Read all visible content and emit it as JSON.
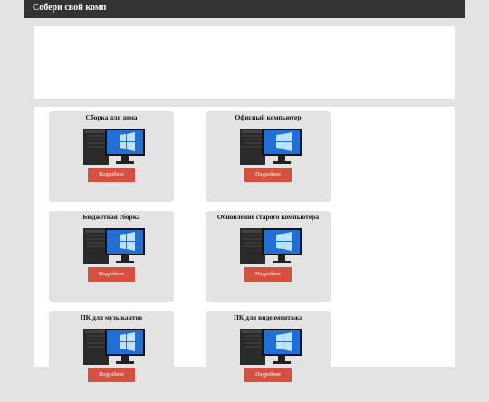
{
  "header": {
    "site_title": "Собери свой комп"
  },
  "products": [
    {
      "title": "Сборка для дома",
      "button_label": "Подробнее"
    },
    {
      "title": "Офисный компьютер",
      "button_label": "Подробнее"
    },
    {
      "title": "Бюджетная сборка",
      "button_label": "Подробнее"
    },
    {
      "title": "Обновление старого компьютера",
      "button_label": "Подробнее"
    },
    {
      "title": "ПК для музыкантов",
      "button_label": "Подробнее"
    },
    {
      "title": "ПК для видеомонтажа",
      "button_label": "Подробнее"
    }
  ],
  "colors": {
    "header_bg": "#333333",
    "page_bg": "#e3e3e3",
    "card_bg": "#e3e3e3",
    "button_bg": "#d65040"
  }
}
